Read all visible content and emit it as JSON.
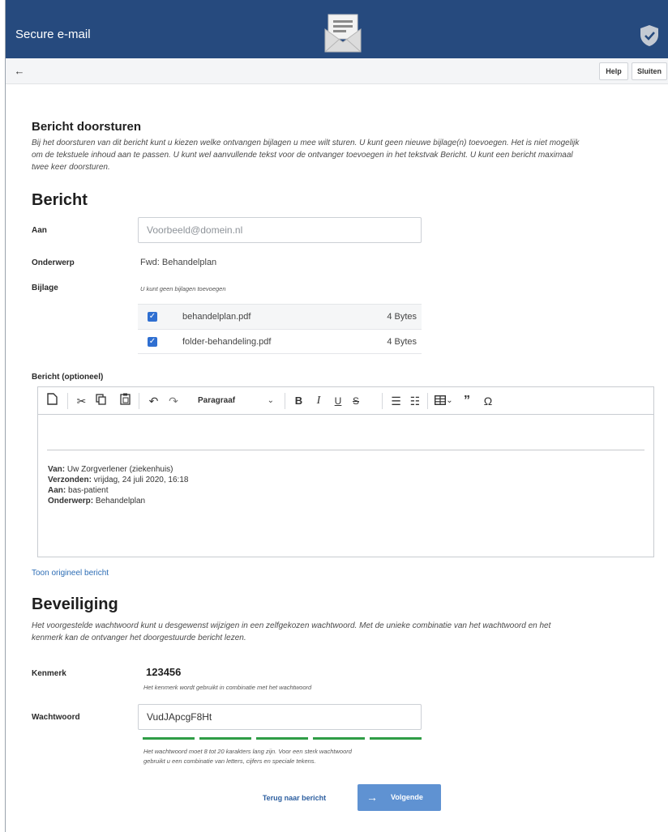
{
  "header": {
    "app_title": "Secure e-mail",
    "icons": [
      "envelope-icon",
      "shield-icon"
    ],
    "brand_color": "#264a7e"
  },
  "toolbar": {
    "back_icon": "←",
    "help_label": "Help",
    "close_label": "Sluiten"
  },
  "forward": {
    "title": "Bericht doorsturen",
    "intro_lines": [
      "Bij het doorsturen van dit bericht kunt u kiezen welke ontvangen bijlagen u mee wilt sturen. U kunt geen nieuwe bijlage(n) toevoegen. Het is niet mogelijk",
      "om de tekstuele inhoud aan te passen. U kunt wel aanvullende tekst voor de ontvanger toevoegen in het tekstvak Bericht. U kunt een bericht maximaal",
      "twee keer doorsturen."
    ]
  },
  "message": {
    "title": "Bericht",
    "to_label": "Aan",
    "to_placeholder": "Voorbeeld@domein.nl",
    "subject_label": "Onderwerp",
    "subject_value": "Fwd: Behandelplan",
    "attachment_label": "Bijlage",
    "attachment_note": "U kunt geen bijlagen toevoegen",
    "attachments": [
      {
        "name": "behandelplan.pdf",
        "size": "4 Bytes",
        "checked": true
      },
      {
        "name": "folder-behandeling.pdf",
        "size": "4 Bytes",
        "checked": true
      }
    ]
  },
  "editor": {
    "label": "Bericht (optioneel)",
    "format_select": "Paragraaf",
    "tools": [
      "new-document-icon",
      "cut-icon",
      "copy-icon",
      "paste-icon",
      "undo-icon",
      "redo-icon",
      "bold-icon",
      "italic-icon",
      "underline-icon",
      "strikethrough-icon",
      "bulleted-list-icon",
      "numbered-list-icon",
      "table-icon",
      "blockquote-icon",
      "special-character-icon"
    ],
    "meta": [
      {
        "key": "Van:",
        "value": "Uw Zorgverlener (ziekenhuis)"
      },
      {
        "key": "Verzonden:",
        "value": "vrijdag, 24 juli 2020, 16:18"
      },
      {
        "key": "Aan:",
        "value": "bas-patient"
      },
      {
        "key": "Onderwerp:",
        "value": "Behandelplan"
      }
    ]
  },
  "show_original_link": "Toon origineel bericht",
  "security": {
    "title": "Beveiliging",
    "intro_lines": [
      "Het voorgestelde wachtwoord kunt u desgewenst wijzigen in een zelfgekozen wachtwoord. Met de unieke combinatie van het wachtwoord en het",
      "kenmerk kan de ontvanger het doorgestuurde bericht lezen."
    ],
    "reference_label": "Kenmerk",
    "reference_value": "123456",
    "reference_note": "Het kenmerk wordt gebruikt in combinatie met het wachtwoord",
    "password_label": "Wachtwoord",
    "password_value": "VudJApcgF8Ht",
    "strength_segments_filled": 5,
    "strength_segments_total": 5,
    "strength_color": "#2f9d46",
    "password_hint_lines": [
      "Het wachtwoord moet 8 tot 20 karakters lang zijn. Voor een sterk wachtwoord",
      "gebruikt u een combinatie van letters, cijfers en speciale tekens."
    ]
  },
  "actions": {
    "back_label": "Terug naar bericht",
    "next_label": "Volgende",
    "next_icon": "arrow-right-icon",
    "next_color": "#5f92d2"
  }
}
